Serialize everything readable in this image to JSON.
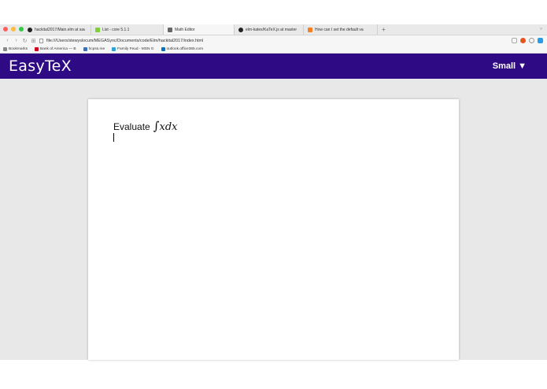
{
  "browser": {
    "tabs": [
      {
        "label": "hackital2017/Main.elm at sav",
        "icon": "github-icon",
        "active": false
      },
      {
        "label": "List - core 5.1.1",
        "icon": "elm-icon",
        "active": false
      },
      {
        "label": "Math Editor",
        "icon": "page-icon",
        "active": true
      },
      {
        "label": "elm-katex/KaTeX.js at master",
        "icon": "github-icon",
        "active": false
      },
      {
        "label": "How can I set the default va",
        "icon": "stackoverflow-icon",
        "active": false
      }
    ],
    "new_tab_label": "+",
    "url": "file:///Users/stewyslocum/MEGASync/Documents/code/Elm/hackital2017/index.html",
    "bookmarks": [
      {
        "label": "Bookmarks"
      },
      {
        "label": "Bank of America — B"
      },
      {
        "label": "hcpss.me"
      },
      {
        "label": "Family Feud - MSN G"
      },
      {
        "label": "outlook.office365.com"
      }
    ]
  },
  "app": {
    "title": "EasyTeX",
    "size_menu": {
      "label": "Small",
      "arrow": "▼"
    }
  },
  "editor": {
    "text": "Evaluate",
    "math_integral": "∫",
    "math_expr": "xdx"
  },
  "colors": {
    "appbar": "#2e0a84",
    "workspace": "#e8e8e8",
    "paper": "#ffffff"
  }
}
